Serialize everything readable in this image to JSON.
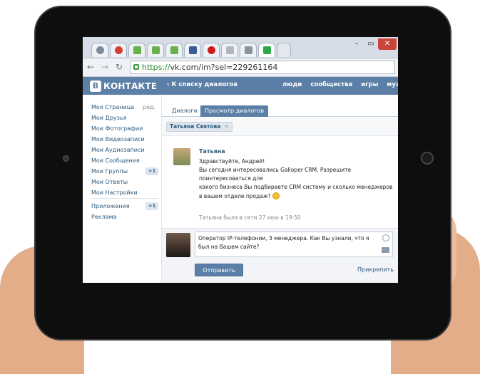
{
  "browser": {
    "url_scheme": "https://",
    "url_rest": "vk.com/im?sel=229261164",
    "tabs": [
      {
        "icon": "globe-icon",
        "color": "#7b8a99"
      },
      {
        "icon": "chrome-icon",
        "color": "#d93b2f"
      },
      {
        "icon": "green-page-icon",
        "color": "#6ab04c"
      },
      {
        "icon": "green-page-icon",
        "color": "#6ab04c"
      },
      {
        "icon": "green-page-icon",
        "color": "#6ab04c"
      },
      {
        "icon": "facebook-icon",
        "color": "#3b5998"
      },
      {
        "icon": "opera-icon",
        "color": "#cc1b1b"
      },
      {
        "icon": "page-icon",
        "color": "#b0b7bf"
      },
      {
        "icon": "trash-icon",
        "color": "#8a939c"
      },
      {
        "icon": "calendar-icon",
        "color": "#2aa84a"
      }
    ],
    "window_controls": {
      "minimize": "–",
      "maximize": "▭",
      "close": "✕"
    }
  },
  "vk": {
    "logo_letter": "В",
    "logo_text": "КОНТАКТЕ",
    "back_link": "‹ К списку диалогов",
    "top_nav": [
      "люди",
      "сообщества",
      "игры",
      "музы"
    ],
    "sidebar": {
      "items": [
        "Моя Страница",
        "Мои Друзья",
        "Мои Фотографии",
        "Мои Видеозаписи",
        "Мои Аудиозаписи",
        "Мои Сообщения",
        "Мои Группы",
        "Мои Ответы",
        "Мои Настройки"
      ],
      "edit_label": "ред.",
      "groups_badge": "+1",
      "extra_items": [
        "Приложения",
        "Реклама"
      ],
      "apps_badge": "+1"
    },
    "tabs": {
      "dialogs": "Диалоги",
      "view": "Просмотр диалогов"
    },
    "chip": {
      "name": "Татьяна Святова",
      "remove": "✕"
    },
    "message": {
      "author": "Татьяна",
      "lines": [
        "Здравствуйте, Андрей!",
        "Вы сегодня интересовались Galloper CRM. Разрешите",
        "поинтересоваться для",
        "какого бизнеса Вы подбираете CRM систему и сколько менеджеров",
        "в вашем отделе продаж?"
      ],
      "seen": "Татьяна была в сети 27 июн в 19:50"
    },
    "composer": {
      "text": "Оператор IP-телефонии, 3 менеджера. Как Вы узнали, что я был на Вашем сайте?",
      "send": "Отправить",
      "attach": "Прикрепить"
    }
  },
  "colors": {
    "vk_blue": "#5b7fa6",
    "link": "#2b587a",
    "tablet_bezel": "#0e0e0e"
  }
}
